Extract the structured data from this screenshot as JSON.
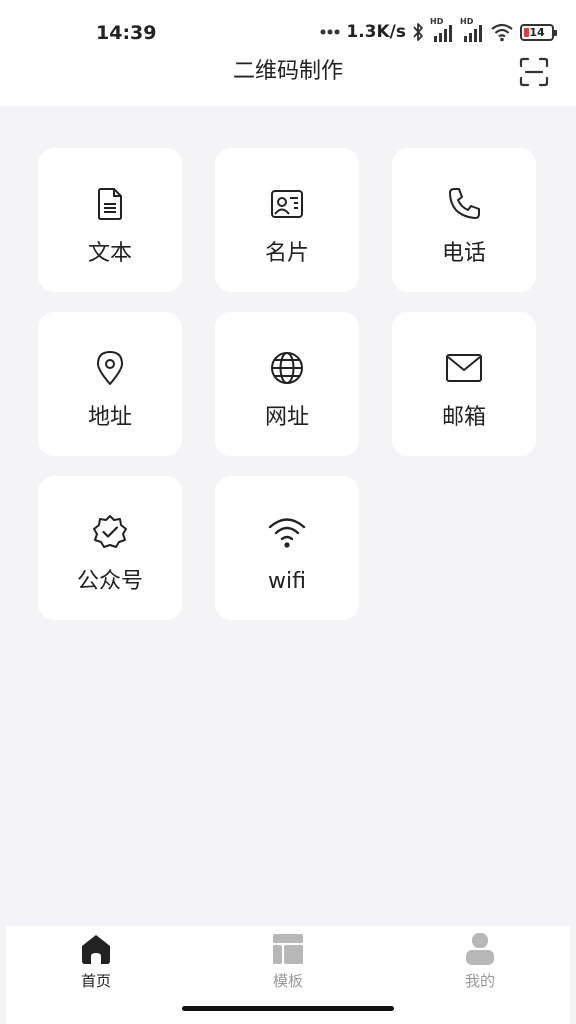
{
  "status_bar": {
    "time": "14:39",
    "network_speed": "1.3K/s",
    "signal_tag_1": "HD",
    "signal_tag_2": "HD",
    "battery_level": "14"
  },
  "header": {
    "title": "二维码制作",
    "scan_icon": "scan-icon"
  },
  "tiles": [
    {
      "label": "文本",
      "icon": "document-icon"
    },
    {
      "label": "名片",
      "icon": "business-card-icon"
    },
    {
      "label": "电话",
      "icon": "phone-icon"
    },
    {
      "label": "地址",
      "icon": "location-pin-icon"
    },
    {
      "label": "网址",
      "icon": "globe-icon"
    },
    {
      "label": "邮箱",
      "icon": "envelope-icon"
    },
    {
      "label": "公众号",
      "icon": "verified-badge-icon"
    },
    {
      "label": "wifi",
      "icon": "wifi-icon"
    }
  ],
  "tabbar": {
    "items": [
      {
        "label": "首页",
        "icon": "home-icon",
        "active": true
      },
      {
        "label": "模板",
        "icon": "template-icon",
        "active": false
      },
      {
        "label": "我的",
        "icon": "user-icon",
        "active": false
      }
    ]
  },
  "colors": {
    "background": "#f4f4f6",
    "tile_background": "#ffffff",
    "icon_stroke": "#222222",
    "tab_active": "#222222",
    "tab_inactive": "#9a9a9a"
  }
}
